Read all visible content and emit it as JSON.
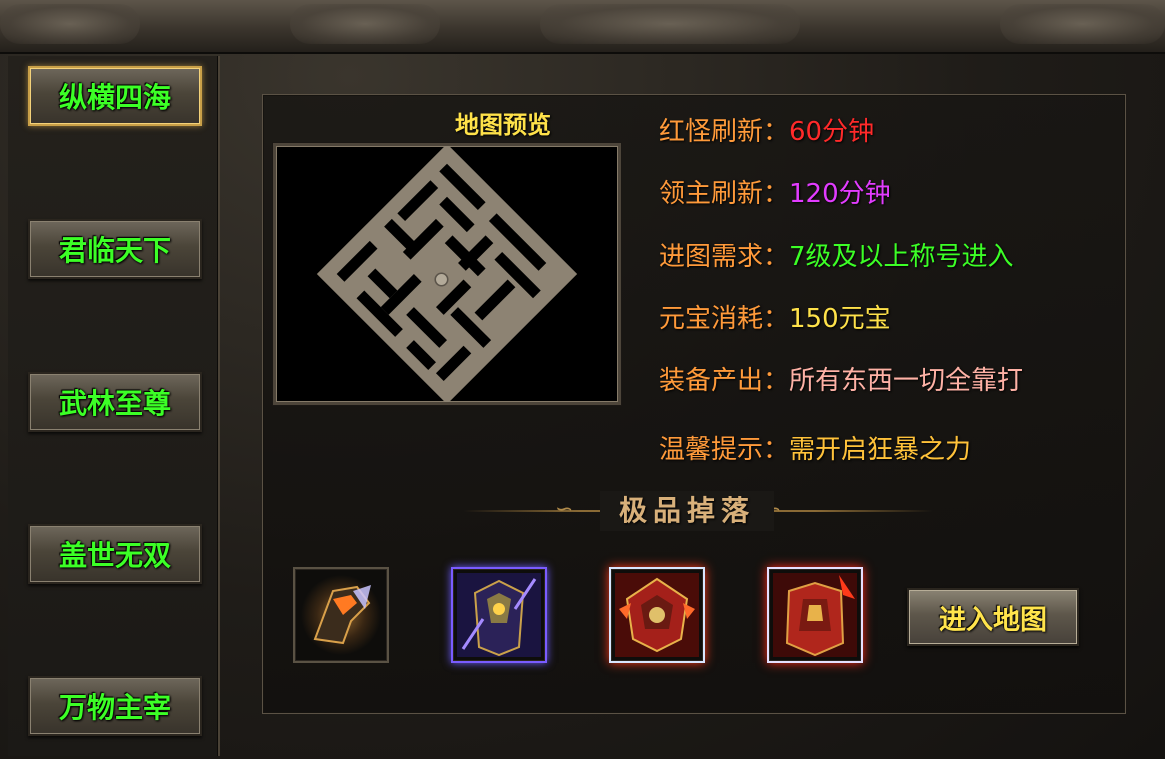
{
  "sidebar": {
    "items": [
      {
        "label": "纵横四海",
        "active": true
      },
      {
        "label": "君临天下",
        "active": false
      },
      {
        "label": "武林至尊",
        "active": false
      },
      {
        "label": "盖世无双",
        "active": false
      },
      {
        "label": "万物主宰",
        "active": false
      }
    ]
  },
  "preview": {
    "title": "地图预览"
  },
  "info": [
    {
      "label": "红怪刷新：",
      "value": "60分钟",
      "value_color": "#ff2a2a"
    },
    {
      "label": "领主刷新：",
      "value": "120分钟",
      "value_color": "#e23cff"
    },
    {
      "label": "进图需求：",
      "value": "7级及以上称号进入",
      "value_color": "#3cff26"
    },
    {
      "label": "元宝消耗：",
      "value": "150元宝",
      "value_color": "#ffe24a"
    },
    {
      "label": "装备产出：",
      "value": "所有东西一切全靠打",
      "value_color": "#ffb2a6"
    },
    {
      "label": "温馨提示：",
      "value": "需开启狂暴之力",
      "value_color": "#ffc23a"
    }
  ],
  "drops": {
    "title": "极品掉落",
    "items": [
      {
        "icon": "glove-item-icon"
      },
      {
        "icon": "purple-armor-item-icon"
      },
      {
        "icon": "red-helmet-item-icon"
      },
      {
        "icon": "red-armor-item-icon"
      }
    ]
  },
  "actions": {
    "enter_label": "进入地图"
  },
  "colors": {
    "label": "#ff9a3a",
    "sidebar_text": "#3cff26",
    "title": "#ffe24a"
  }
}
